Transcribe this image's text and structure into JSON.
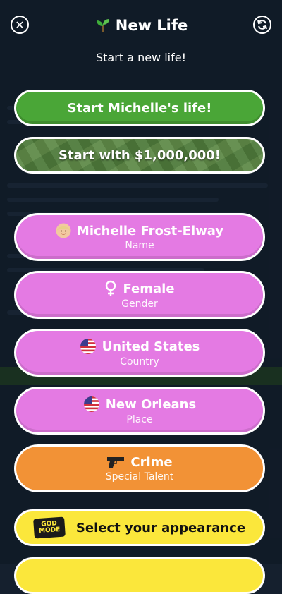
{
  "header": {
    "title": "New Life",
    "subtitle": "Start a new life!"
  },
  "actions": {
    "start_label": "Start Michelle's life!",
    "start_money_label": "Start with $1,000,000!"
  },
  "fields": [
    {
      "value": "Michelle Frost-Elway",
      "label": "Name",
      "icon": "avatar-icon"
    },
    {
      "value": "Female",
      "label": "Gender",
      "icon": "female-symbol-icon"
    },
    {
      "value": "United States",
      "label": "Country",
      "icon": "us-flag-icon"
    },
    {
      "value": "New Orleans",
      "label": "Place",
      "icon": "us-flag-icon"
    },
    {
      "value": "Crime",
      "label": "Special Talent",
      "icon": "pistol-icon"
    }
  ],
  "appearance": {
    "label": "Select your appearance",
    "badge": "GOD MODE"
  },
  "colors": {
    "green": "#4aa637",
    "pink": "#e47ae3",
    "orange": "#f29236",
    "yellow": "#fbe73b"
  }
}
